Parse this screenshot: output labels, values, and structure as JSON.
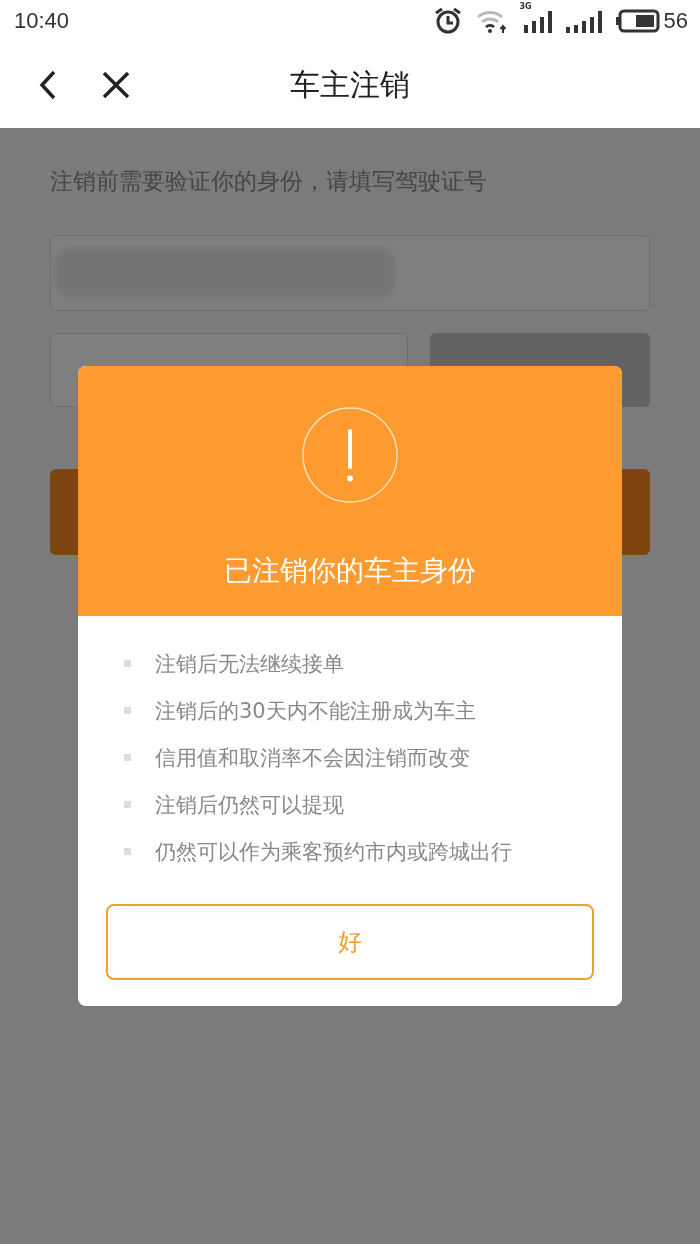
{
  "status_bar": {
    "time": "10:40",
    "network": "3G",
    "battery": "56"
  },
  "header": {
    "title": "车主注销"
  },
  "form": {
    "instruction": "注销前需要验证你的身份，请填写驾驶证号"
  },
  "dialog": {
    "title": "已注销你的车主身份",
    "items": [
      "注销后无法继续接单",
      "注销后的30天内不能注册成为车主",
      "信用值和取消率不会因注销而改变",
      "注销后仍然可以提现",
      "仍然可以作为乘客预约市内或跨城出行"
    ],
    "button": "好"
  }
}
